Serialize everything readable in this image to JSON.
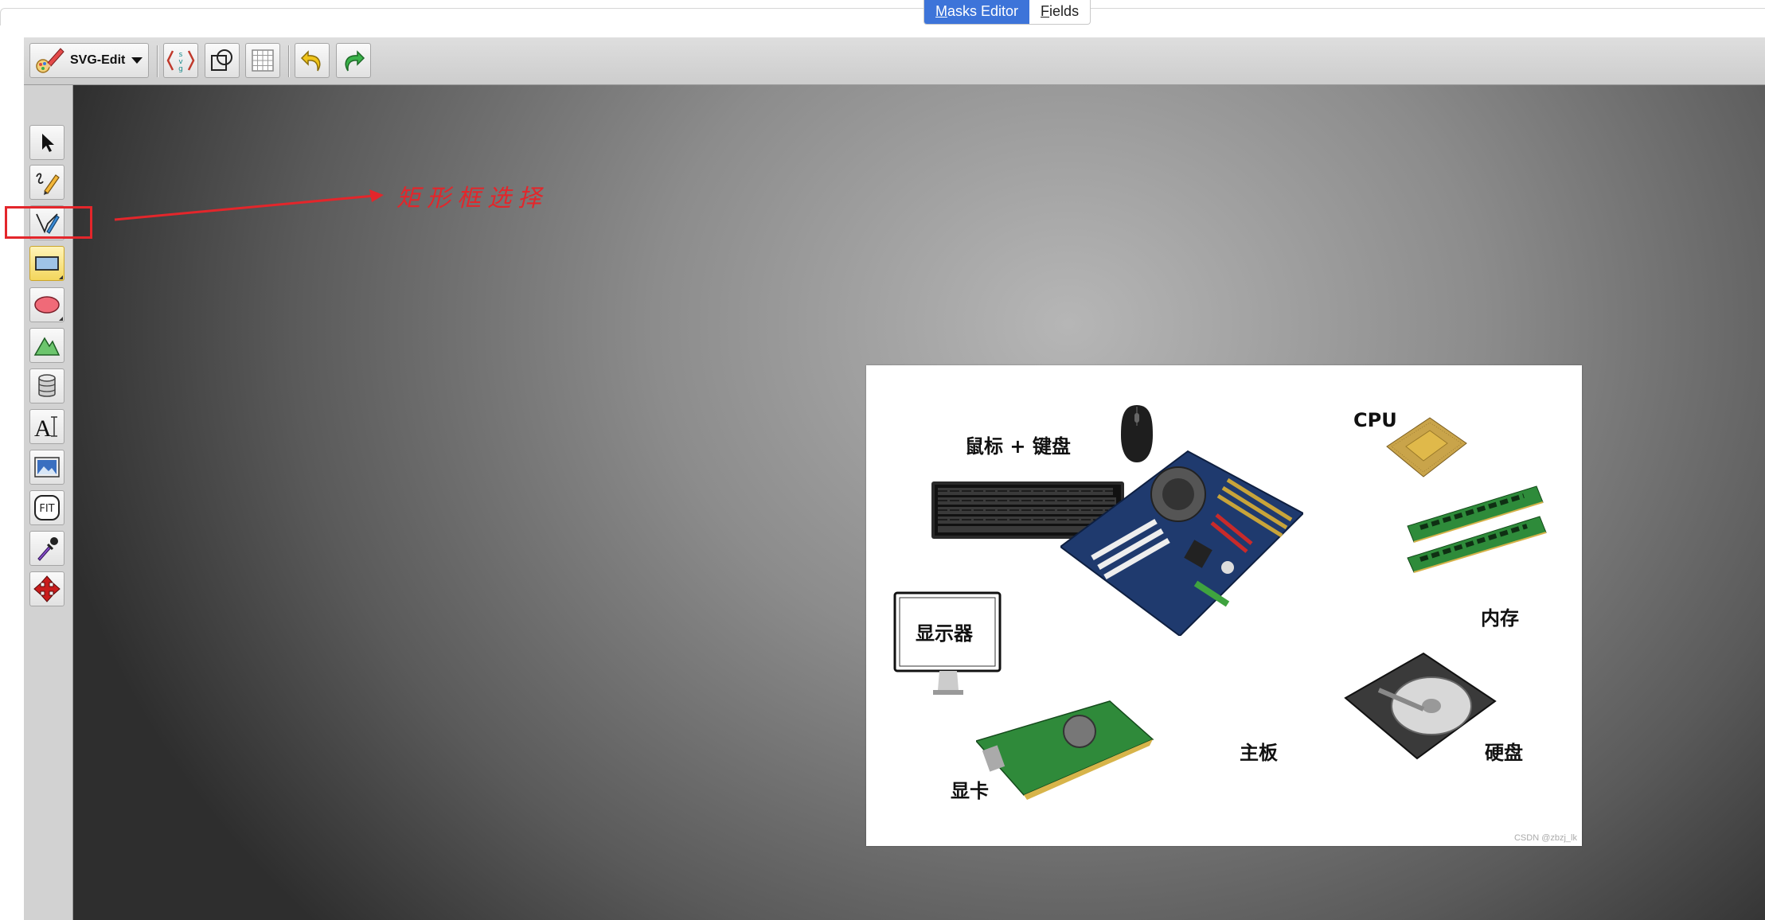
{
  "tabs": [
    {
      "label": "Masks Editor",
      "accel": "M",
      "rest": "asks Editor",
      "active": true
    },
    {
      "label": "Fields",
      "accel": "F",
      "rest": "ields",
      "active": false
    }
  ],
  "toolbar": {
    "menu_label": "SVG-Edit",
    "buttons": [
      {
        "name": "source-button",
        "icon": "svg-source-icon"
      },
      {
        "name": "wireframe-button",
        "icon": "wireframe-icon"
      },
      {
        "name": "grid-button",
        "icon": "grid-icon"
      },
      {
        "name": "undo-button",
        "icon": "undo-icon"
      },
      {
        "name": "redo-button",
        "icon": "redo-icon"
      }
    ]
  },
  "left_tools": [
    {
      "name": "select-tool",
      "icon": "cursor-icon"
    },
    {
      "name": "freehand-tool",
      "icon": "pencil-icon"
    },
    {
      "name": "path-tool",
      "icon": "pen-icon"
    },
    {
      "name": "rect-tool",
      "icon": "rectangle-icon",
      "selected": true
    },
    {
      "name": "ellipse-tool",
      "icon": "ellipse-icon"
    },
    {
      "name": "shape-library-tool",
      "icon": "shapes-icon"
    },
    {
      "name": "database-tool",
      "icon": "cylinder-icon"
    },
    {
      "name": "text-tool",
      "icon": "text-icon"
    },
    {
      "name": "image-tool",
      "icon": "image-icon"
    },
    {
      "name": "zoom-fit-tool",
      "icon": "fit-icon",
      "label": "FIT"
    },
    {
      "name": "eyedropper-tool",
      "icon": "eyedropper-icon"
    },
    {
      "name": "pan-tool",
      "icon": "move-arrows-icon"
    }
  ],
  "annotation": {
    "text": "矩形框选择",
    "color": "#e3262b"
  },
  "canvas": {
    "labels": {
      "mouse_keyboard": "鼠标 + 键盘",
      "cpu": "CPU",
      "monitor": "显示器",
      "memory": "内存",
      "motherboard": "主板",
      "hard_disk": "硬盘",
      "graphics_card": "显卡"
    },
    "watermark": "CSDN @zbzj_lk"
  },
  "colors": {
    "tab_active": "#3d74d9",
    "tool_selected": "#f3d65c",
    "annotation": "#e3262b"
  }
}
